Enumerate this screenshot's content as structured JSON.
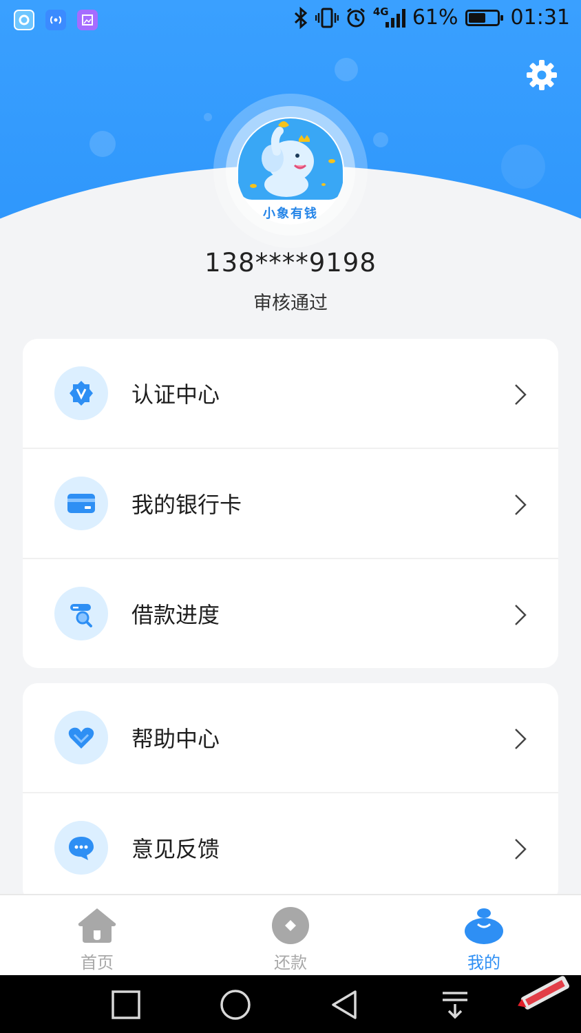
{
  "status_bar": {
    "network": "4G",
    "battery_percent": "61%",
    "battery_level": 0.61,
    "time": "01:31"
  },
  "profile": {
    "logo_text": "小象有钱",
    "phone": "138****9198",
    "status": "审核通过"
  },
  "menu_group_1": [
    {
      "label": "认证中心",
      "icon": "verify-badge-icon"
    },
    {
      "label": "我的银行卡",
      "icon": "bank-card-icon"
    },
    {
      "label": "借款进度",
      "icon": "loan-progress-icon"
    }
  ],
  "menu_group_2": [
    {
      "label": "帮助中心",
      "icon": "heart-icon"
    },
    {
      "label": "意见反馈",
      "icon": "chat-bubble-icon"
    }
  ],
  "tabbar": {
    "home": "首页",
    "repay": "还款",
    "mine": "我的"
  },
  "colors": {
    "brand": "#2e96fb",
    "icon_bg": "#dcefff",
    "icon_fg": "#2e8ff4",
    "tab_inactive": "#a8a8a8"
  }
}
